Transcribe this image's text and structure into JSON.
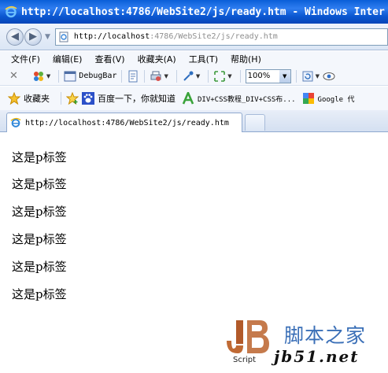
{
  "window": {
    "title": "http://localhost:4786/WebSite2/js/ready.htm - Windows Inter"
  },
  "address_bar": {
    "url_host": "http://localhost",
    "url_rest": ":4786/WebSite2/js/ready.htm"
  },
  "menu": {
    "items": [
      "文件(F)",
      "编辑(E)",
      "查看(V)",
      "收藏夹(A)",
      "工具(T)",
      "帮助(H)"
    ]
  },
  "toolbar": {
    "debugbar_label": "DebugBar",
    "zoom_value": "100%"
  },
  "favorites_bar": {
    "favorites_label": "收藏夹",
    "links": [
      "百度一下，你就知道",
      "DIV+CSS教程_DIV+CSS布...",
      "Google 代"
    ]
  },
  "tab": {
    "title": "http://localhost:4786/WebSite2/js/ready.htm"
  },
  "page": {
    "paragraphs": [
      "这是p标签",
      "这是p标签",
      "这是p标签",
      "这是p标签",
      "这是p标签",
      "这是p标签"
    ]
  },
  "watermark": {
    "site_name": "脚本之家",
    "domain": "jb51.net",
    "logo_caption": "Script"
  }
}
